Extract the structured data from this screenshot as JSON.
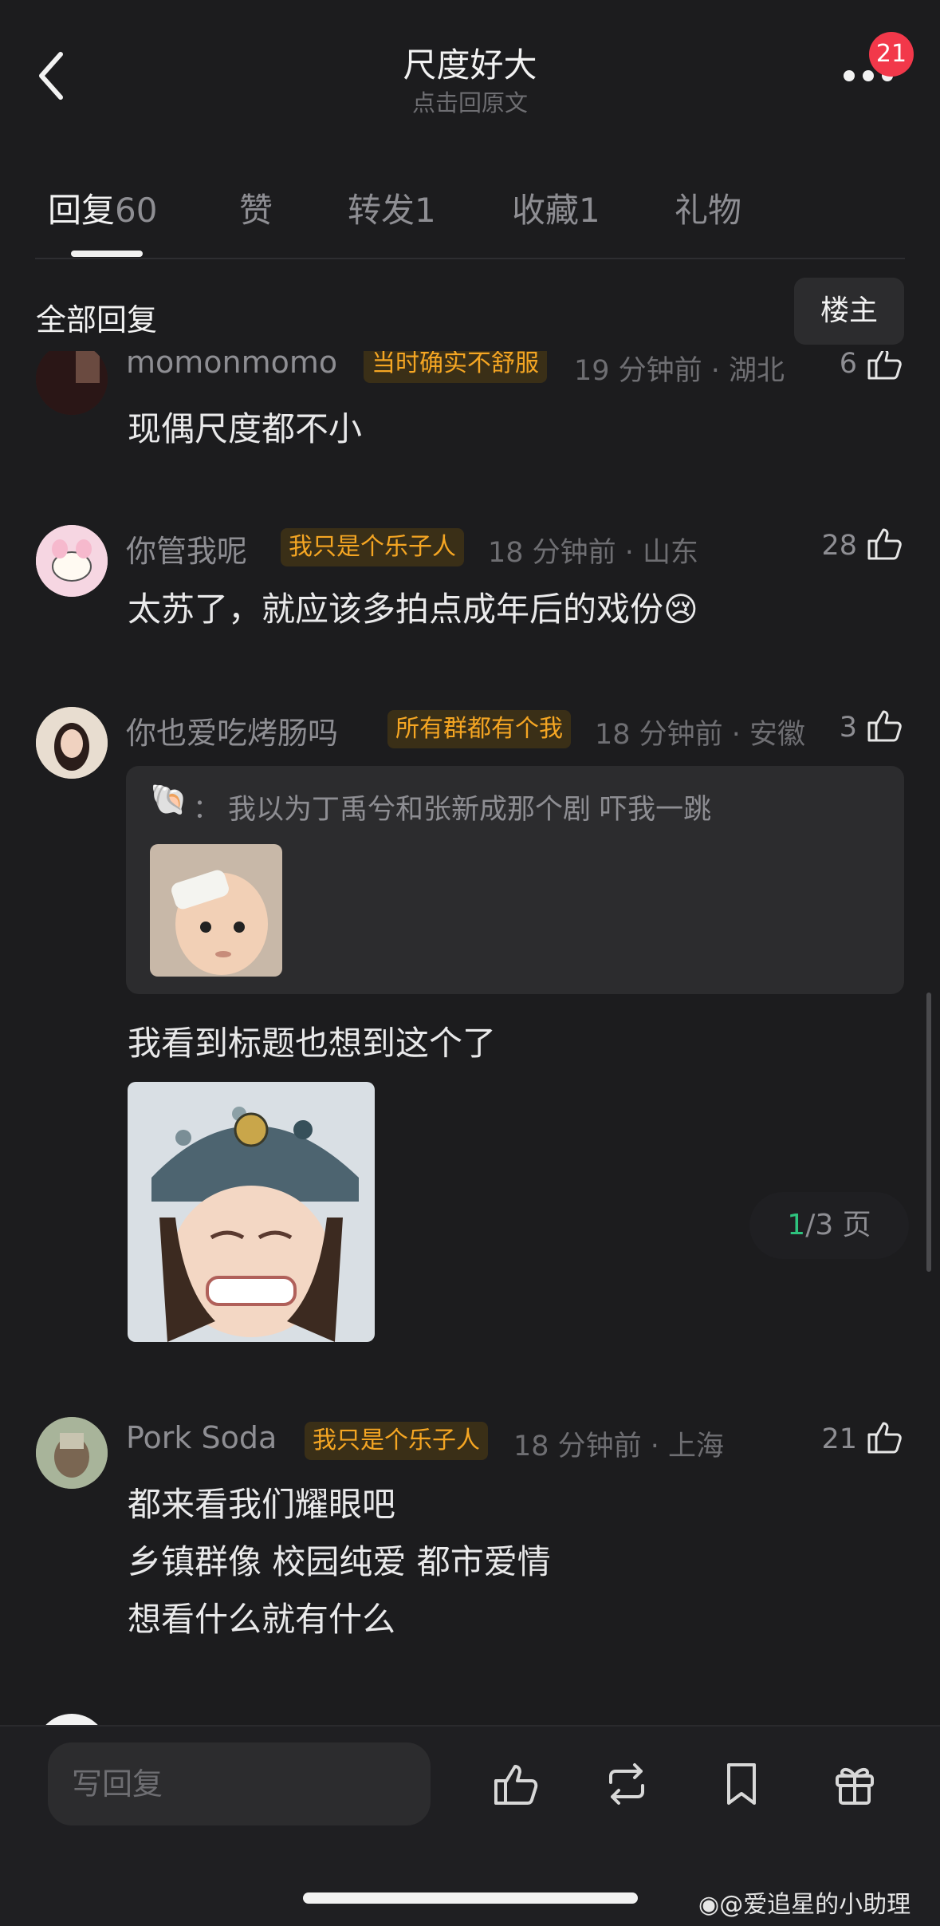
{
  "header": {
    "title": "尺度好大",
    "subtitle": "点击回原文",
    "notification_count": "21"
  },
  "tabs": [
    {
      "label": "回复",
      "count": "60"
    },
    {
      "label": "赞",
      "count": ""
    },
    {
      "label": "转发",
      "count": "1"
    },
    {
      "label": "收藏",
      "count": "1"
    },
    {
      "label": "礼物",
      "count": ""
    }
  ],
  "section": {
    "label": "全部回复",
    "op_button": "楼主"
  },
  "comments": [
    {
      "username": "momonmomo",
      "tag": "当时确实不舒服",
      "time": "19 分钟前 · 湖北",
      "likes": "6",
      "lines": [
        "现偶尺度都不小"
      ]
    },
    {
      "username": "你管我呢",
      "tag": "我只是个乐子人",
      "time": "18 分钟前 · 山东",
      "likes": "28",
      "lines": [
        "太苏了，就应该多拍点成年后的戏份"
      ],
      "emoji": "😢"
    },
    {
      "username": "你也爱吃烤肠吗",
      "tag": "所有群都有个我",
      "time": "18 分钟前 · 安徽",
      "likes": "3",
      "quote": {
        "icon": "🐚",
        "sep": "：",
        "text": "我以为丁禹兮和张新成那个剧 吓我一跳"
      },
      "lines": [
        "我看到标题也想到这个了"
      ]
    },
    {
      "username": "Pork Soda",
      "tag": "我只是个乐子人",
      "time": "18 分钟前 · 上海",
      "likes": "21",
      "lines": [
        "都来看我们耀眼吧",
        "乡镇群像 校园纯爱 都市爱情",
        "想看什么就有什么"
      ]
    }
  ],
  "pagination": {
    "current": "1",
    "rest": "/3 页"
  },
  "bottom_bar": {
    "reply_placeholder": "写回复",
    "icons": [
      "like-icon",
      "repost-icon",
      "bookmark-icon",
      "gift-icon"
    ]
  },
  "watermark": "@爱追星的小助理",
  "colors": {
    "background": "#1c1c1e",
    "tag_bg": "#3a2f17",
    "tag_text": "#f5a623",
    "badge": "#f2384a",
    "page_current": "#2ec27e"
  }
}
